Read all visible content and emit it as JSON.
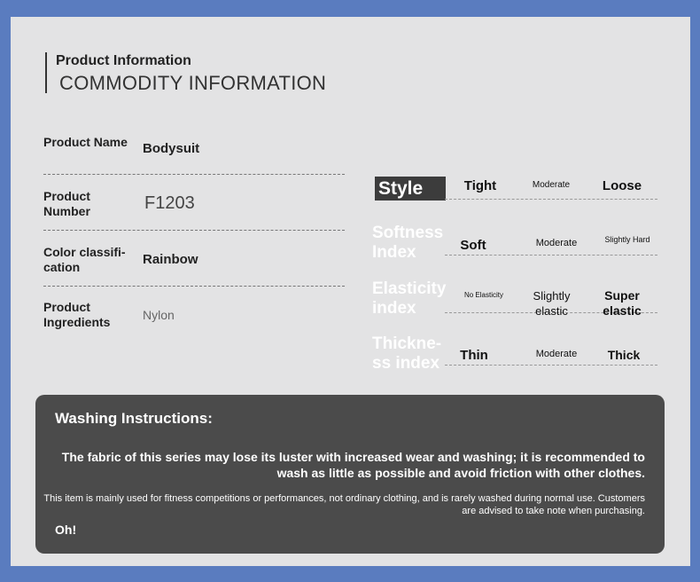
{
  "header": {
    "title": "Product Information",
    "subtitle": "COMMODITY INFORMATION"
  },
  "specs": [
    {
      "label": "Product Name",
      "value": "Bodysuit"
    },
    {
      "label": "Product Number",
      "value": "F1203"
    },
    {
      "label": "Color classifi-cation",
      "value": "Rainbow"
    },
    {
      "label": "Product Ingredients",
      "value": "Nylon"
    }
  ],
  "indices": [
    {
      "name": "Style",
      "options": [
        "Tight",
        "Moderate",
        "Loose"
      ]
    },
    {
      "name": "Softness Index",
      "options": [
        "Soft",
        "Moderate",
        "Slightly Hard"
      ]
    },
    {
      "name": "Elasticity index",
      "options": [
        "No Elasticity",
        "Slightly elastic",
        "Super elastic"
      ]
    },
    {
      "name": "Thickne-ss index",
      "options": [
        "Thin",
        "Moderate",
        "Thick"
      ]
    }
  ],
  "washing": {
    "title": "Washing Instructions:",
    "para1": "The fabric of this series may lose its luster with increased wear and washing; it is recommended to wash as little as possible and avoid friction with other clothes.",
    "para2": "This item is mainly used for fitness competitions or performances, not ordinary clothing, and is rarely washed during normal use. Customers are advised to take note when purchasing.",
    "closing": "Oh!"
  }
}
